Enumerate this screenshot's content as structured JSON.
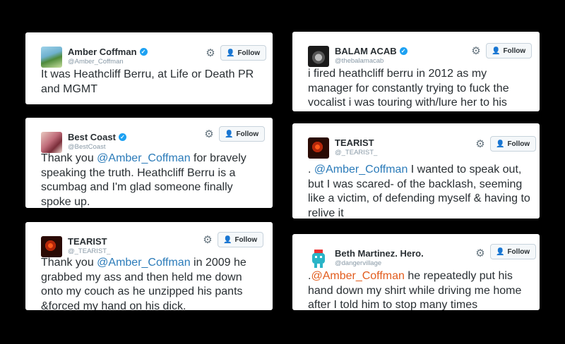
{
  "ui": {
    "follow_label": "Follow"
  },
  "tweets": [
    {
      "name": "Amber Coffman",
      "handle": "@Amber_Coffman",
      "verified": true,
      "avatar_icon": "avatar-amber",
      "text": {
        "before": "It was Heathcliff Berru, at Life or Death PR and MGMT",
        "mention": "",
        "after": ""
      }
    },
    {
      "name": "Best Coast",
      "handle": "@BestCoast",
      "verified": true,
      "avatar_icon": "avatar-best-coast",
      "text": {
        "before": "Thank you ",
        "mention": "@Amber_Coffman",
        "after": " for bravely speaking the truth. Heathcliff Berru is a scumbag and I'm glad someone finally spoke up."
      }
    },
    {
      "name": "TEARIST",
      "handle": "@_TEARIST_",
      "verified": false,
      "avatar_icon": "avatar-tearist",
      "text": {
        "before": "Thank you ",
        "mention": "@Amber_Coffman",
        "after": " in 2009 he grabbed my ass and then held me down onto my couch as he unzipped his pants &forced my hand on his dick."
      }
    },
    {
      "name": "BALAM ACAB",
      "handle": "@thebalamacab",
      "verified": true,
      "avatar_icon": "avatar-balam-acab",
      "text": {
        "before": "i fired heathcliff berru in 2012 as my manager for constantly trying to fuck the vocalist i was touring with/lure her to his hotel room",
        "mention": "",
        "after": ""
      }
    },
    {
      "name": "TEARIST",
      "handle": "@_TEARIST_",
      "verified": false,
      "avatar_icon": "avatar-tearist",
      "text": {
        "before": ". ",
        "mention": "@Amber_Coffman",
        "after": " I wanted to speak out, but I was scared- of the backlash, seeming like a victim, of defending myself & having to relive it"
      }
    },
    {
      "name": "Beth Martinez. Hero.",
      "handle": "@dangervillage",
      "verified": false,
      "avatar_icon": "avatar-beth",
      "text": {
        "before": ".",
        "mention": "@Amber_Coffman",
        "after": " he repeatedly put his hand down my shirt while driving me home after I told him to stop many times"
      }
    }
  ],
  "colors": {
    "mention": "#2b7bb9",
    "mention_alt": "#e25c1d",
    "verified": "#1da1f2",
    "background": "#000000"
  }
}
